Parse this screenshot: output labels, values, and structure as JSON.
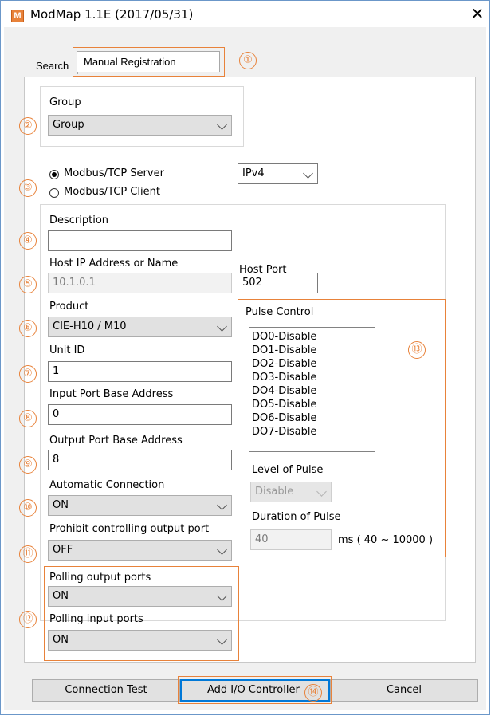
{
  "window": {
    "title": "ModMap 1.1E (2017/05/31)",
    "app_icon_letter": "M",
    "close_glyph": "✕"
  },
  "tabs": [
    {
      "label": "Search",
      "active": false
    },
    {
      "label": "Manual Registration",
      "active": true
    }
  ],
  "markers": [
    "①",
    "②",
    "③",
    "④",
    "⑤",
    "⑥",
    "⑦",
    "⑧",
    "⑨",
    "⑩",
    "⑪",
    "⑫",
    "⑬",
    "⑭"
  ],
  "group": {
    "label": "Group",
    "value": "Group"
  },
  "mode": {
    "server_label": "Modbus/TCP Server",
    "client_label": "Modbus/TCP Client",
    "selected": "server",
    "ip_version": "IPv4"
  },
  "description": {
    "label": "Description",
    "value": ""
  },
  "host": {
    "label": "Host IP Address or Name",
    "value": "10.1.0.1"
  },
  "port": {
    "label": "Host Port",
    "value": "502"
  },
  "product": {
    "label": "Product",
    "value": "CIE-H10 / M10"
  },
  "unit_id": {
    "label": "Unit ID",
    "value": "1"
  },
  "input_base": {
    "label": "Input Port Base Address",
    "value": "0"
  },
  "output_base": {
    "label": "Output Port Base Address",
    "value": "8"
  },
  "auto_connect": {
    "label": "Automatic Connection",
    "value": "ON"
  },
  "prohibit_output": {
    "label": "Prohibit controlling output port",
    "value": "OFF"
  },
  "polling_output": {
    "label": "Polling output ports",
    "value": "ON"
  },
  "polling_input": {
    "label": "Polling input ports",
    "value": "ON"
  },
  "pulse": {
    "title": "Pulse Control",
    "items": [
      "DO0-Disable",
      "DO1-Disable",
      "DO2-Disable",
      "DO3-Disable",
      "DO4-Disable",
      "DO5-Disable",
      "DO6-Disable",
      "DO7-Disable"
    ],
    "level_label": "Level of Pulse",
    "level_value": "Disable",
    "duration_label": "Duration of Pulse",
    "duration_value": "40",
    "duration_unit": "ms ( 40 ~ 10000 )"
  },
  "buttons": {
    "connection_test": "Connection Test",
    "add_controller": "Add I/O Controller",
    "cancel": "Cancel"
  },
  "colors": {
    "accent": "#e8823a",
    "focus": "#0078d7"
  }
}
